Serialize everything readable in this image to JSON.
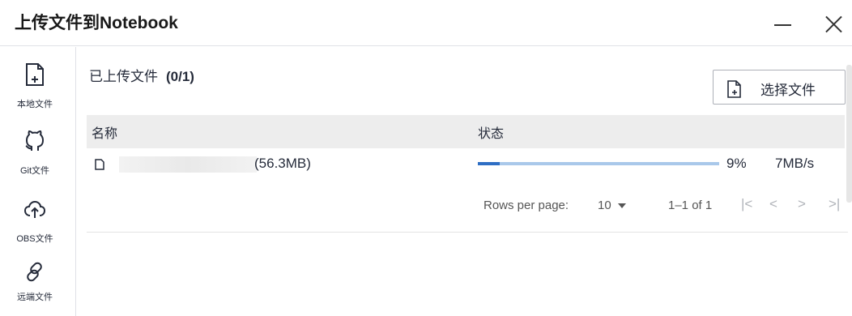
{
  "dialog": {
    "title": "上传文件到Notebook"
  },
  "sidebar": {
    "items": [
      {
        "label": "本地文件",
        "icon": "file-add-icon"
      },
      {
        "label": "Git文件",
        "icon": "github-icon"
      },
      {
        "label": "OBS文件",
        "icon": "cloud-upload-icon"
      },
      {
        "label": "远端文件",
        "icon": "link-icon"
      }
    ]
  },
  "main": {
    "uploaded_title": "已上传文件",
    "uploaded_count": "(0/1)",
    "select_button": "选择文件"
  },
  "table": {
    "columns": [
      "名称",
      "状态"
    ],
    "rows": [
      {
        "name": "",
        "size": "(56.3MB)",
        "progress": 9,
        "percent": "9%",
        "speed": "7MB/s"
      }
    ]
  },
  "pagination": {
    "rows_per_page_label": "Rows per page:",
    "rows_per_page_value": "10",
    "range": "1–1 of 1",
    "first": "|<",
    "prev": "<",
    "next": ">",
    "last": ">|"
  },
  "colors": {
    "progress_fill": "#2e6ec4",
    "progress_track": "#a9c8ea",
    "header_bg": "#ededed"
  }
}
